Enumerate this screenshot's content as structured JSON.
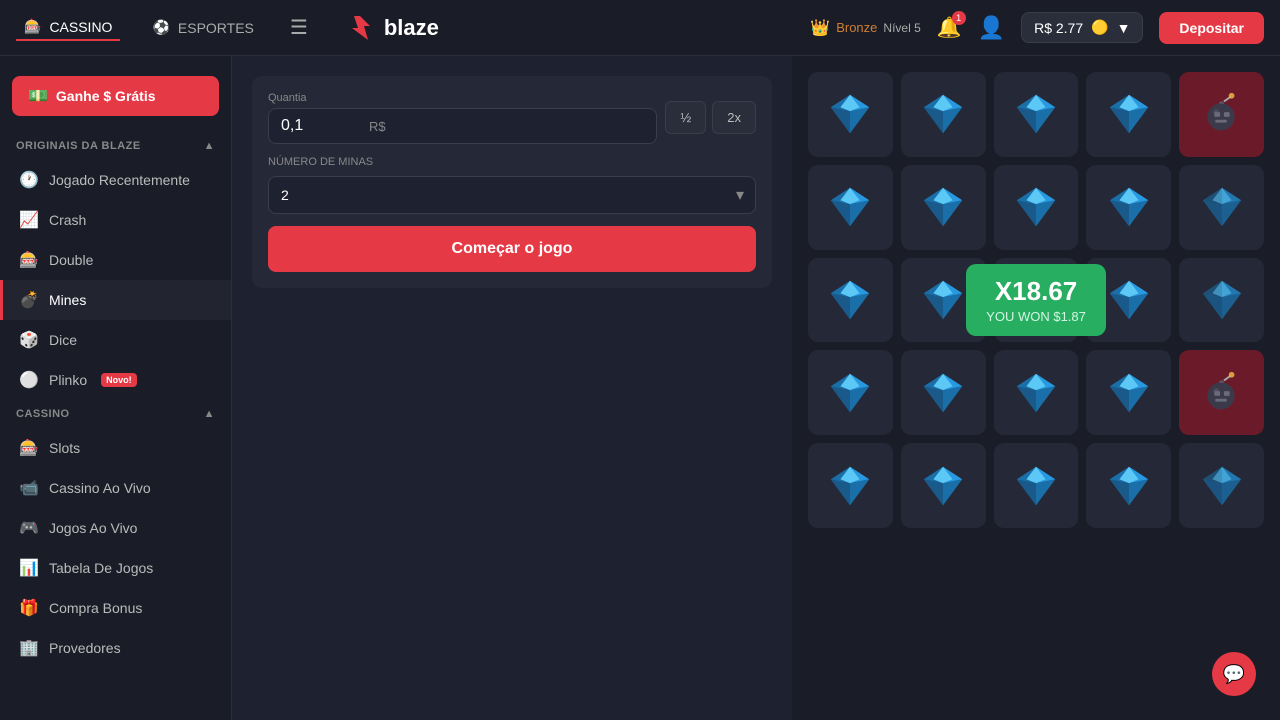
{
  "header": {
    "logo_text": "blaze",
    "nav": [
      {
        "label": "CASSINO",
        "active": true
      },
      {
        "label": "ESPORTES",
        "active": false
      }
    ],
    "bronze_label": "Bronze",
    "nivel_label": "Nível 5",
    "notification_count": "1",
    "balance": "R$  2.77",
    "deposit_label": "Depositar"
  },
  "sidebar": {
    "free_money_label": "Ganhe $ Grátis",
    "originais_label": "ORIGINAIS DA BLAZE",
    "items_originais": [
      {
        "label": "Jogado Recentemente",
        "icon": "🕐"
      },
      {
        "label": "Crash",
        "icon": "📈"
      },
      {
        "label": "Double",
        "icon": "🎰"
      },
      {
        "label": "Mines",
        "icon": "💣",
        "active": true
      },
      {
        "label": "Dice",
        "icon": "🎲"
      },
      {
        "label": "Plinko",
        "icon": "⚪",
        "new": true
      }
    ],
    "cassino_label": "CASSINO",
    "items_cassino": [
      {
        "label": "Slots",
        "icon": "🎰"
      },
      {
        "label": "Cassino Ao Vivo",
        "icon": "📹"
      },
      {
        "label": "Jogos Ao Vivo",
        "icon": "🎮"
      },
      {
        "label": "Tabela De Jogos",
        "icon": "📊"
      },
      {
        "label": "Compra Bonus",
        "icon": "🎁"
      },
      {
        "label": "Provedores",
        "icon": "🏢"
      }
    ]
  },
  "game": {
    "bet_label": "Quantia",
    "bet_value": "0,1",
    "currency_label": "R$",
    "half_label": "½",
    "double_label": "2x",
    "mines_label": "NÚMERO DE MINAS",
    "mines_value": "2",
    "start_label": "Começar o jogo",
    "win_multiplier": "X18.67",
    "win_amount": "YOU WON $1.87"
  },
  "grid": {
    "rows": 5,
    "cols": 5,
    "cells": [
      "diamond",
      "diamond",
      "diamond",
      "diamond",
      "bomb",
      "diamond",
      "diamond",
      "diamond",
      "diamond",
      "diamond",
      "diamond",
      "diamond",
      "win",
      "diamond",
      "diamond",
      "diamond",
      "diamond",
      "diamond",
      "diamond",
      "bomb",
      "diamond",
      "diamond",
      "diamond",
      "diamond",
      "diamond"
    ]
  },
  "chat_icon": "💬"
}
